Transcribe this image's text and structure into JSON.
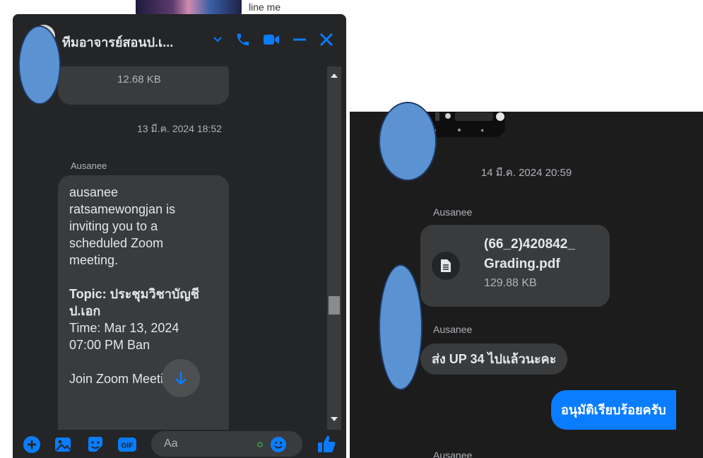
{
  "background_strip": {
    "text": "line me"
  },
  "left_chat": {
    "header": {
      "title": "ทีมอาจารย์สอนป.เ..."
    },
    "messages": {
      "file_bubble_size": "12.68 KB",
      "timestamp": "13 มี.ค. 2024 18:52",
      "sender": "Ausanee",
      "zoom_message_lines": [
        "ausanee",
        "ratsamewongjan is",
        "inviting you to a",
        "scheduled Zoom",
        "meeting.",
        "",
        "Topic: ประชุมวิชาบัญชี",
        "ป.เอก",
        "Time: Mar 13, 2024",
        "07:00 PM Ban",
        "",
        "Join Zoom Meeting"
      ]
    },
    "composer": {
      "placeholder": "Aa"
    },
    "icons": [
      "chevron-down-icon",
      "phone-icon",
      "video-icon",
      "minimize-icon",
      "close-icon",
      "plus-icon",
      "image-icon",
      "sticker-icon",
      "gif-icon",
      "emoji-icon",
      "like-icon",
      "scroll-down-icon"
    ],
    "accent": "#0a7cff"
  },
  "right_chat": {
    "timestamp": "14 มี.ค. 2024 20:59",
    "sender_1": "Ausanee",
    "file": {
      "name_line1": "(66_2)420842_",
      "name_line2": "Grading.pdf",
      "size": "129.88 KB"
    },
    "sender_2": "Ausanee",
    "received_text": "ส่ง UP 34 ไปแล้วนะคะ",
    "sent_text": "อนุมัติเรียบร้อยครับ",
    "sender_3": "Ausanee",
    "accent": "#0a7cff"
  }
}
